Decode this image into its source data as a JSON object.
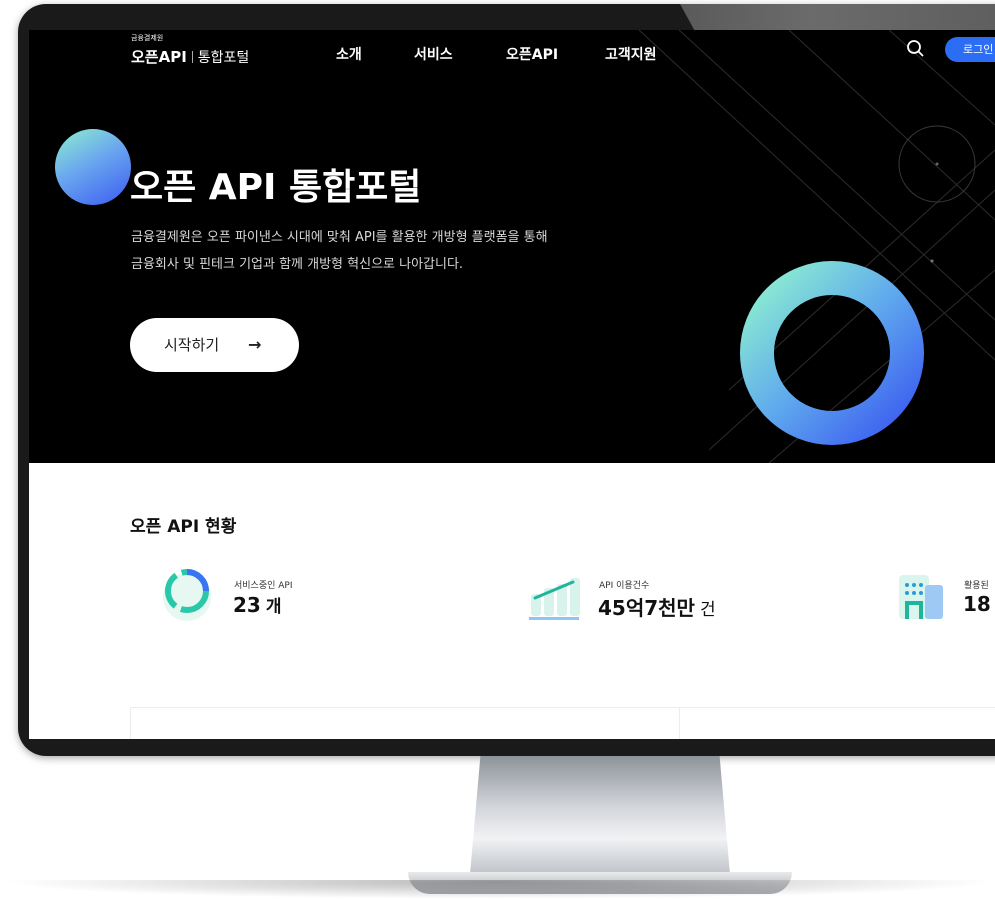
{
  "header": {
    "org_small": "금융결제원",
    "brand_main": "오픈API",
    "brand_sub": "통합포털",
    "nav": [
      "소개",
      "서비스",
      "오픈API",
      "고객지원"
    ],
    "login_label": "로그인"
  },
  "hero": {
    "title": "오픈 API 통합포털",
    "desc_line1": "금융결제원은 오픈 파이낸스 시대에 맞춰 API를 활용한 개방형 플랫폼을 통해",
    "desc_line2": "금융회사 및 핀테크 기업과 함께 개방형 혁신으로 나아갑니다.",
    "start_label": "시작하기",
    "start_arrow": "→"
  },
  "status": {
    "title": "오픈 API 현황",
    "stats": [
      {
        "label": "서비스중인 API",
        "value": "23",
        "unit": "개",
        "icon": "ring-chart-icon"
      },
      {
        "label": "API 이용건수",
        "value": "45억7천만",
        "unit": "건",
        "icon": "bar-chart-icon"
      },
      {
        "label": "활용된",
        "value": "18",
        "unit": "",
        "icon": "building-icon"
      }
    ]
  },
  "colors": {
    "accent_blue": "#2b6ef5",
    "gradient_mint": "#8ef0cf",
    "gradient_blue": "#3b5bf0",
    "hero_bg": "#000000"
  }
}
